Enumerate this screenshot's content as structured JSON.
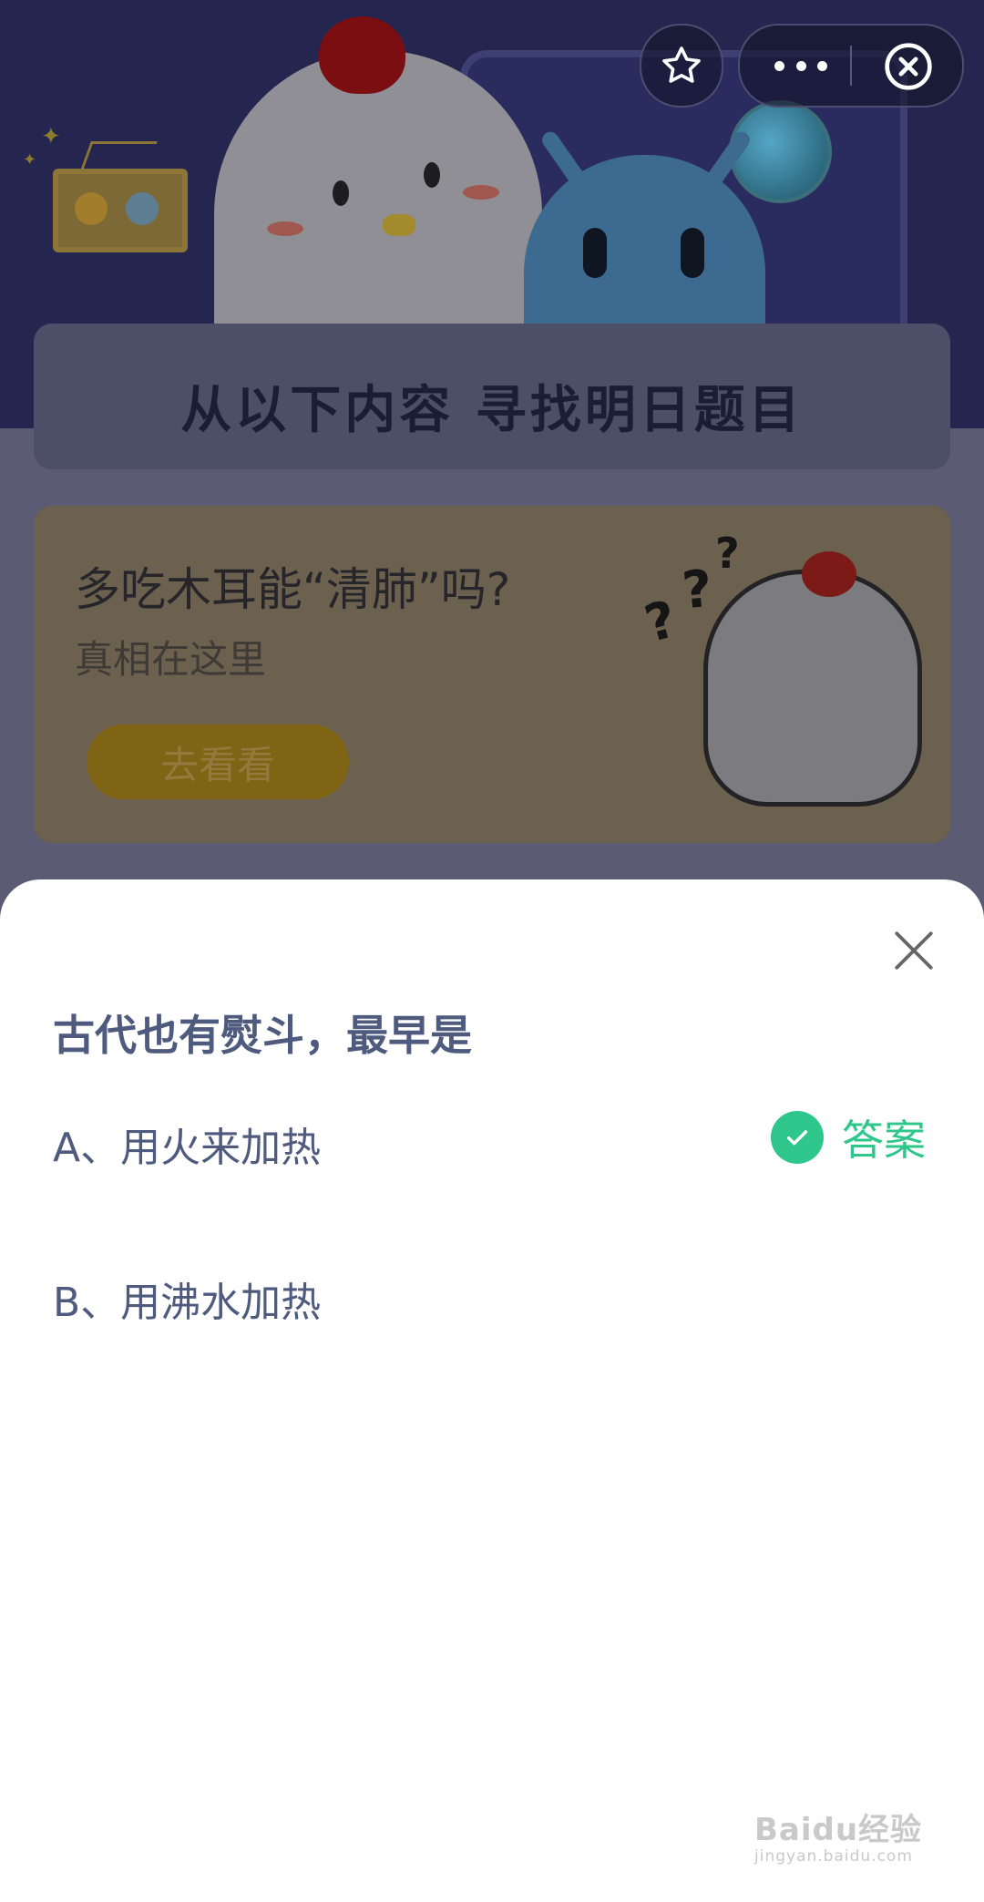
{
  "background": {
    "heading": "从以下内容  寻找明日题目",
    "article": {
      "title": "多吃木耳能“清肺”吗?",
      "subtitle": "真相在这里",
      "button_label": "去看看"
    }
  },
  "top_controls": {
    "icons": [
      "star-icon",
      "more-icon",
      "close-circle-icon"
    ]
  },
  "sheet": {
    "question": "古代也有熨斗，最早是",
    "options": [
      {
        "label": "A、用火来加热",
        "is_answer": true
      },
      {
        "label": "B、用沸水加热",
        "is_answer": false
      }
    ],
    "answer_tag": "答案",
    "accent_color": "#2ec68a"
  },
  "watermark": {
    "main": "Baidu经验",
    "sub": "jingyan.baidu.com"
  }
}
